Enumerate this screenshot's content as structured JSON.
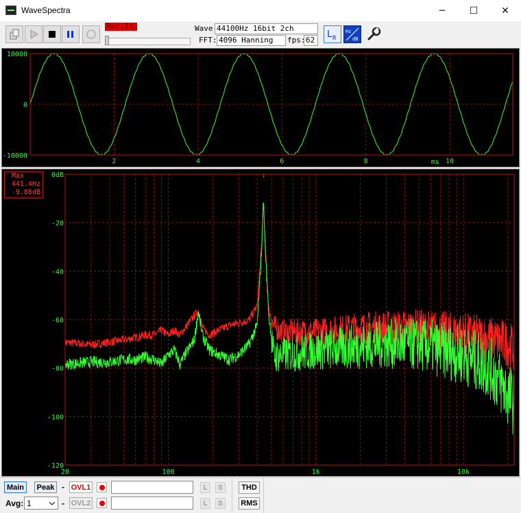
{
  "window": {
    "title": "WaveSpectra",
    "minimize_icon": "─",
    "maximize_icon": "☐",
    "close_icon": "✕"
  },
  "toolbar": {
    "rec_in_label": "Rec.In.",
    "wave_label": "Wave:",
    "wave_value": "44100Hz 16bit 2ch",
    "fft_label": "FFT:",
    "fft_value": "4096 Hanning",
    "fps_label": "fps:",
    "fps_value": "62",
    "buttons": [
      "open-icon",
      "play-icon",
      "stop-icon",
      "pause-icon",
      "record-icon",
      "lr-icon",
      "hz-db-icon",
      "settings-wrench-icon"
    ]
  },
  "waveform": {
    "y_ticks": [
      "10000",
      "0",
      "-10000"
    ],
    "x_ticks": [
      "2",
      "4",
      "6",
      "8",
      "10"
    ],
    "x_unit": "ms"
  },
  "spectrum": {
    "y_ticks": [
      "0dB",
      "-20",
      "-40",
      "-60",
      "-80",
      "-100",
      "-120"
    ],
    "x_ticks": [
      "20",
      "100",
      "1k",
      "10k"
    ],
    "max_label": "Max",
    "max_freq": "441.4Hz",
    "max_level": "-9.86dB"
  },
  "colors": {
    "trace_green": "#33ff33",
    "trace_red": "#ff2020",
    "frame_red": "#c01010",
    "grid_dash": "#8a1010",
    "rec_bg": "#e00000"
  },
  "chart_data": [
    {
      "type": "line",
      "title": "",
      "xlabel": "ms",
      "ylabel": "",
      "xlim": [
        0,
        11.5
      ],
      "ylim": [
        -10000,
        10000
      ],
      "xticks": [
        2,
        4,
        6,
        8,
        10
      ],
      "yticks": [
        10000,
        0,
        -10000
      ],
      "grid": true,
      "series": [
        {
          "frequency_hz": 441.4,
          "amplitude": 10000,
          "start_phase": "zero-crossing",
          "color": "green"
        }
      ]
    },
    {
      "type": "line",
      "title": "",
      "xscale": "log",
      "xlim": [
        20,
        22050
      ],
      "ylim": [
        -120,
        0
      ],
      "xticks": [
        "20",
        "100",
        "1k",
        "10k"
      ],
      "yticks": [
        0,
        -20,
        -40,
        -60,
        -80,
        -100,
        -120
      ],
      "grid": true,
      "annotations": [
        {
          "label": "Max",
          "freq": "441.4Hz",
          "level": "-9.86dB"
        }
      ],
      "series": [
        {
          "channel": "L",
          "color": "red",
          "points": [
            [
              20,
              -69
            ],
            [
              30,
              -70
            ],
            [
              40,
              -69
            ],
            [
              50,
              -68
            ],
            [
              60,
              -67
            ],
            [
              70,
              -66
            ],
            [
              80,
              -66
            ],
            [
              90,
              -64
            ],
            [
              100,
              -66
            ],
            [
              110,
              -64
            ],
            [
              120,
              -66
            ],
            [
              130,
              -63
            ],
            [
              150,
              -58
            ],
            [
              160,
              -56
            ],
            [
              170,
              -63
            ],
            [
              190,
              -66
            ],
            [
              220,
              -64
            ],
            [
              260,
              -62
            ],
            [
              300,
              -61
            ],
            [
              350,
              -60
            ],
            [
              400,
              -54
            ],
            [
              430,
              -28
            ],
            [
              441,
              -10
            ],
            [
              455,
              -30
            ],
            [
              480,
              -56
            ],
            [
              520,
              -62
            ],
            [
              600,
              -64
            ],
            [
              800,
              -64
            ],
            [
              1000,
              -64
            ],
            [
              1500,
              -63
            ],
            [
              2000,
              -62
            ],
            [
              3000,
              -62
            ],
            [
              5000,
              -62
            ],
            [
              7000,
              -63
            ],
            [
              10000,
              -64
            ],
            [
              15000,
              -66
            ],
            [
              20000,
              -68
            ],
            [
              22050,
              -70
            ]
          ]
        },
        {
          "channel": "R",
          "color": "green",
          "points": [
            [
              20,
              -78
            ],
            [
              30,
              -77
            ],
            [
              40,
              -77
            ],
            [
              50,
              -76
            ],
            [
              60,
              -76
            ],
            [
              70,
              -75
            ],
            [
              80,
              -76
            ],
            [
              90,
              -78
            ],
            [
              100,
              -74
            ],
            [
              110,
              -72
            ],
            [
              120,
              -78
            ],
            [
              130,
              -74
            ],
            [
              150,
              -68
            ],
            [
              160,
              -56
            ],
            [
              170,
              -66
            ],
            [
              190,
              -72
            ],
            [
              220,
              -74
            ],
            [
              260,
              -76
            ],
            [
              300,
              -74
            ],
            [
              350,
              -70
            ],
            [
              400,
              -62
            ],
            [
              430,
              -30
            ],
            [
              441,
              -10
            ],
            [
              455,
              -32
            ],
            [
              480,
              -58
            ],
            [
              520,
              -74
            ],
            [
              600,
              -73
            ],
            [
              800,
              -72
            ],
            [
              1000,
              -71
            ],
            [
              1500,
              -70
            ],
            [
              2000,
              -69
            ],
            [
              3000,
              -68
            ],
            [
              5000,
              -68
            ],
            [
              7000,
              -70
            ],
            [
              10000,
              -72
            ],
            [
              15000,
              -77
            ],
            [
              20000,
              -88
            ],
            [
              22050,
              -92
            ]
          ]
        }
      ]
    }
  ],
  "bottom": {
    "main_label": "Main",
    "peak_label": "Peak",
    "dash1": "-",
    "dash2": "-",
    "ovl1_label": "OVL1",
    "ovl2_label": "OVL2",
    "l_label": "L",
    "s_label": "S",
    "thd_label": "THD",
    "rms_label": "RMS",
    "avg_label": "Avg:",
    "avg_value": "1"
  }
}
